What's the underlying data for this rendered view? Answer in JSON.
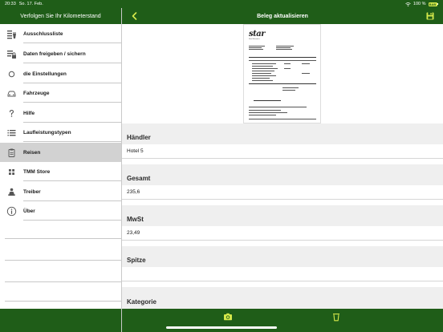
{
  "status_bar": {
    "time": "20:33",
    "date": "So. 17. Feb.",
    "battery_text": "100 %",
    "battery_label": "BAB"
  },
  "sidebar_header": {
    "title": "Verfolgen Sie Ihr Kilometerstand"
  },
  "detail_header": {
    "title": "Beleg aktualisieren"
  },
  "sidebar": {
    "items": [
      {
        "label": "Ausschlussliste",
        "icon": "list-exclude-icon",
        "active": false
      },
      {
        "label": "Daten freigeben / sichern",
        "icon": "share-data-icon",
        "active": false
      },
      {
        "label": "die Einstellungen",
        "icon": "circle-icon",
        "active": false
      },
      {
        "label": "Fahrzeuge",
        "icon": "car-icon",
        "active": false
      },
      {
        "label": "Hilfe",
        "icon": "question-icon",
        "active": false
      },
      {
        "label": "Laufleistungstypen",
        "icon": "list-icon",
        "active": false
      },
      {
        "label": "Reisen",
        "icon": "clipboard-icon",
        "active": true
      },
      {
        "label": "TMM Store",
        "icon": "grid-icon",
        "active": false
      },
      {
        "label": "Treiber",
        "icon": "driver-icon",
        "active": false
      },
      {
        "label": "Über",
        "icon": "info-icon",
        "active": false
      }
    ]
  },
  "receipt": {
    "logo": "star",
    "tagline": "Star Micronics"
  },
  "fields": [
    {
      "label": "Händler",
      "value": "Hotel 5"
    },
    {
      "label": "Gesamt",
      "value": "235,6"
    },
    {
      "label": "MwSt",
      "value": "23,49"
    },
    {
      "label": "Spitze",
      "value": ""
    },
    {
      "label": "Kategorie",
      "value": ""
    }
  ],
  "colors": {
    "primary_green": "#1f5d18",
    "accent_yellow": "#d6e94b",
    "active_row": "#d2d2d2"
  }
}
